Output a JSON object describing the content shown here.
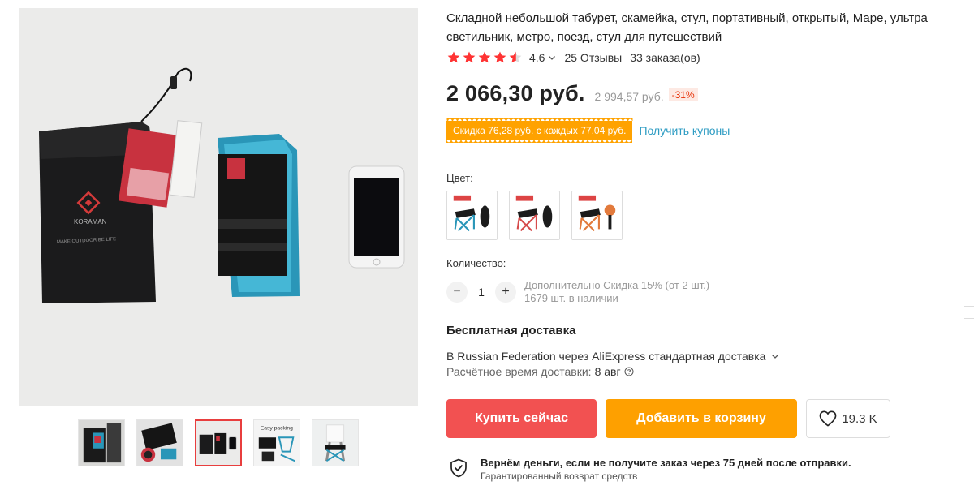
{
  "product": {
    "title": "Складной небольшой табурет, скамейка, стул, портативный, открытый, Маре, ультра светильник, метро, поезд, стул для путешествий",
    "rating": {
      "value": "4.6",
      "stars": 4.6,
      "reviews": "25 Отзывы",
      "orders": "33 заказа(ов)"
    },
    "price": {
      "current": "2 066,30 руб.",
      "old": "2 994,57 руб.",
      "discount": "-31%"
    },
    "coupon": {
      "text": "Скидка 76,28 руб. с каждых 77,04 руб.",
      "link": "Получить купоны"
    },
    "variants": {
      "label": "Цвет:",
      "options": [
        "blue-stool",
        "red-stool",
        "orange-stool"
      ]
    },
    "quantity": {
      "label": "Количество:",
      "value": "1",
      "minus": "−",
      "plus": "+",
      "extra_discount": "Дополнительно Скидка 15% (от 2 шт.)",
      "stock": "1679 шт. в наличии"
    },
    "shipping": {
      "title": "Бесплатная доставка",
      "method": "В Russian Federation через AliExpress стандартная доставка",
      "eta_label": "Расчётное время доставки:",
      "eta_date": "8 авг"
    },
    "actions": {
      "buy": "Купить сейчас",
      "cart": "Добавить в корзину",
      "wishlist_count": "19.3 K"
    },
    "guarantee": {
      "title": "Вернём деньги, если не получите заказ через 75 дней после отправки.",
      "subtitle": "Гарантированный возврат средств"
    }
  },
  "gallery": {
    "selected_index": 2,
    "thumbnails": [
      "stool-in-bag",
      "folded-stool",
      "stool-with-phone",
      "easy-packing",
      "stool-in-use"
    ],
    "image_text": {
      "brand": "KORAMAN",
      "slogan": "MAKE OUTDOOR BE LIFE",
      "packing": "Easy packing"
    }
  },
  "colors": {
    "accent_red": "#f25151",
    "accent_orange": "#fea000",
    "price_discount": "#e62e04",
    "link": "#2e9cc3",
    "star": "#f33"
  }
}
